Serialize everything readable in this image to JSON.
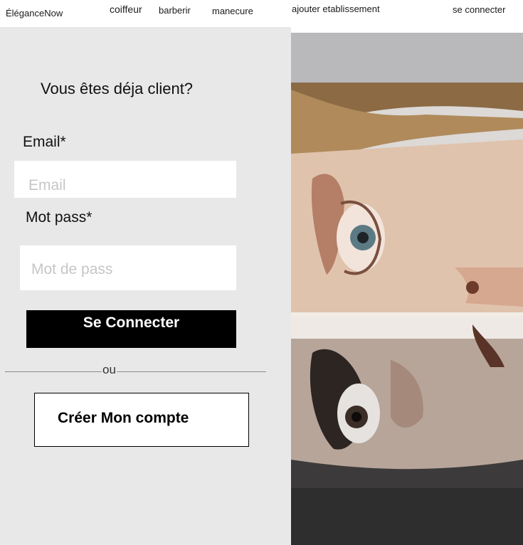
{
  "nav": {
    "brand": "ÉléganceNow",
    "links": [
      "coiffeur",
      "barberir",
      "manecure",
      "ajouter etablissement",
      "se connecter"
    ]
  },
  "login": {
    "heading": "Vous êtes déja client?",
    "email_label": "Email*",
    "email_placeholder": "Email",
    "password_label": "Mot pass*",
    "password_placeholder": "Mot de pass",
    "submit_label": "Se Connecter",
    "separator": "ou",
    "create_account_label": "Créer Mon compte"
  },
  "colors": {
    "panel_bg": "#e8e8e8",
    "button_bg": "#000000",
    "button_text": "#ffffff"
  }
}
